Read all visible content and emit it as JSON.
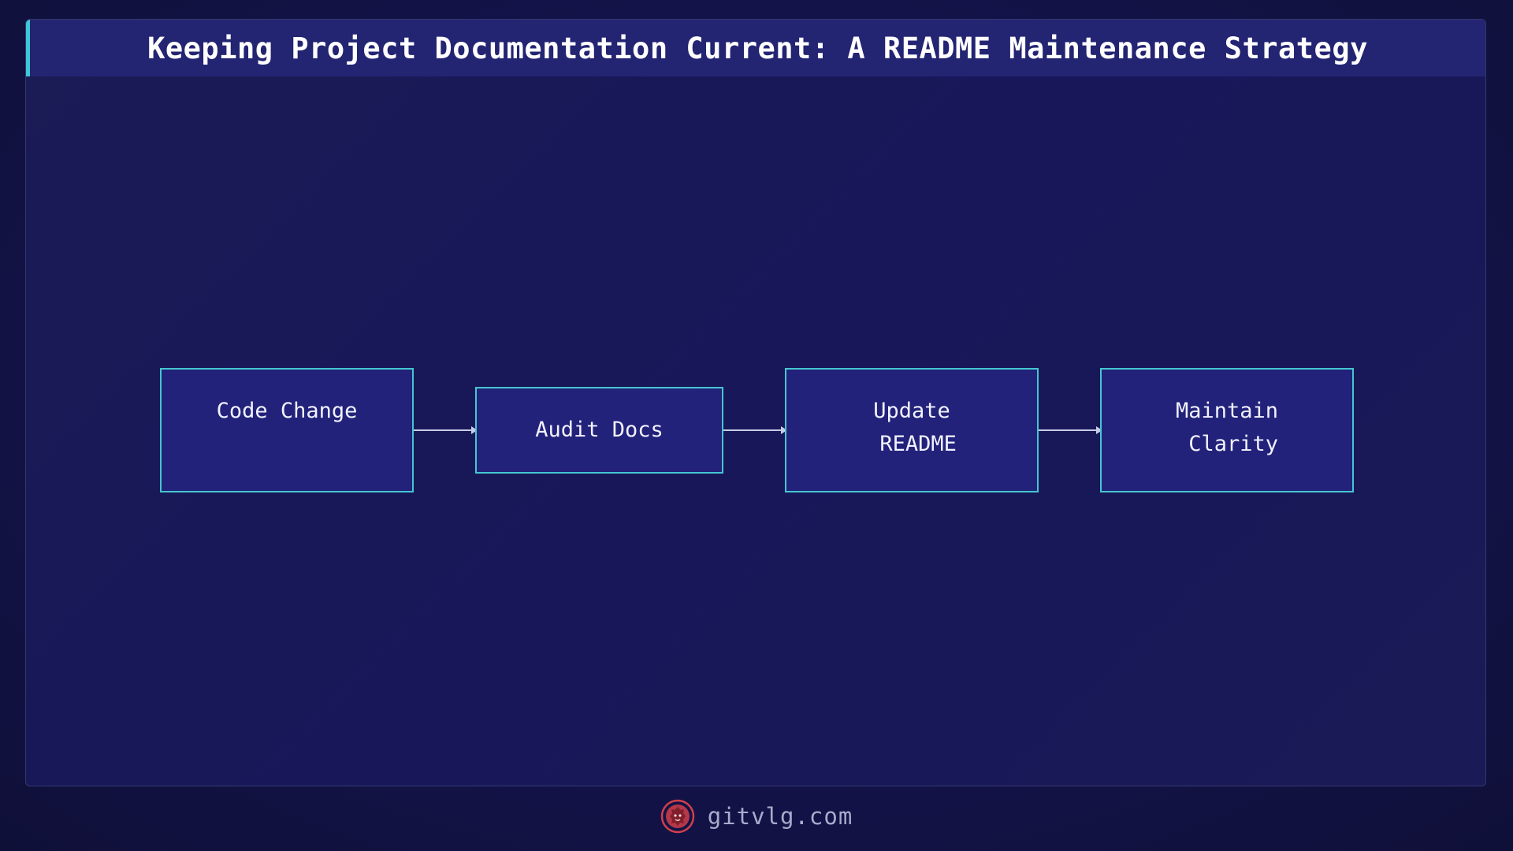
{
  "title": "Keeping Project Documentation Current: A README Maintenance Strategy",
  "nodes": [
    {
      "lines": [
        "Code Change"
      ]
    },
    {
      "lines": [
        "Audit Docs"
      ]
    },
    {
      "lines": [
        "Update",
        " README"
      ]
    },
    {
      "lines": [
        "Maintain",
        " Clarity"
      ]
    }
  ],
  "edges": [
    {
      "from": "Code Change",
      "to": "Audit Docs"
    },
    {
      "from": "Audit Docs",
      "to": "Update README"
    },
    {
      "from": "Update README",
      "to": "Maintain Clarity"
    }
  ],
  "footer": {
    "site": "gitvlg.com",
    "logo_icon": "lion-icon"
  },
  "colors": {
    "accent": "#3ec8d6",
    "node_fill": "#22227a",
    "title_bar": "#232472",
    "logo": "#d0404a"
  }
}
